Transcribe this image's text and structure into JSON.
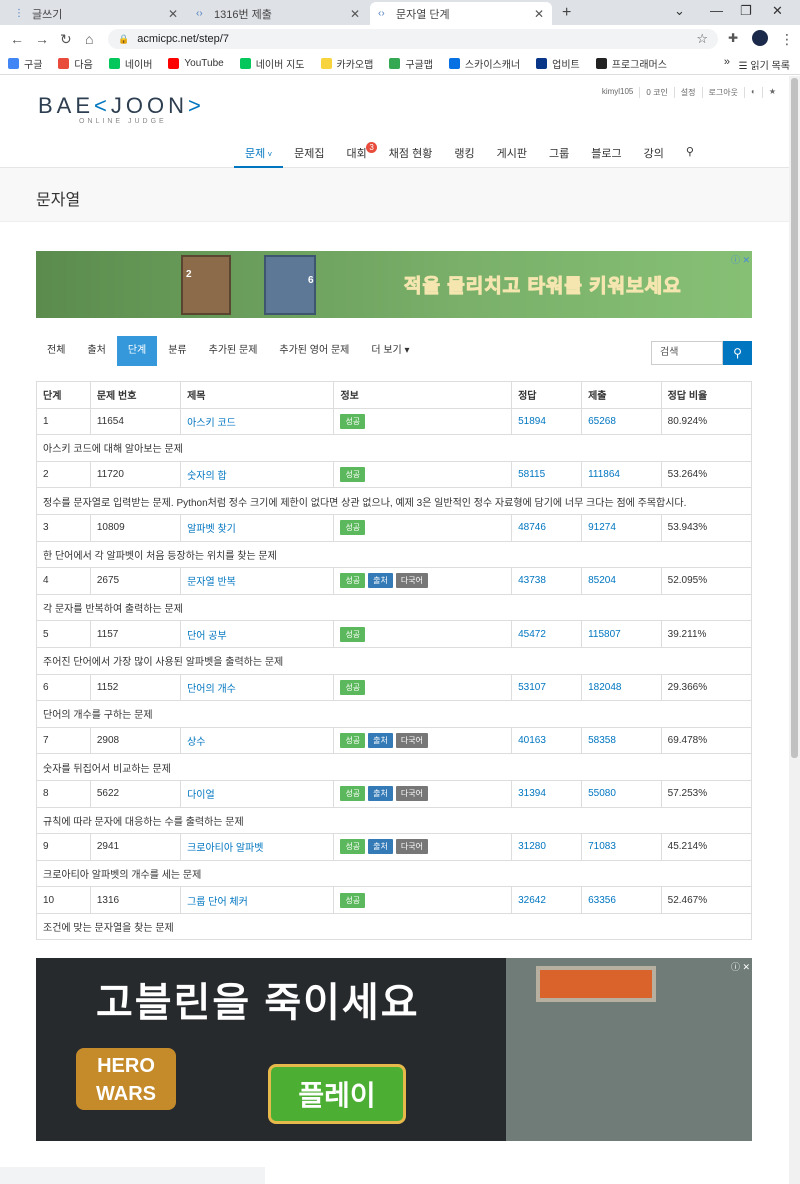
{
  "browser": {
    "tabs": [
      {
        "label": "글쓰기",
        "active": false
      },
      {
        "label": "1316번 제출",
        "active": false
      },
      {
        "label": "문자열 단계",
        "active": true
      }
    ],
    "url": "acmicpc.net/step/7",
    "bookmarks": [
      {
        "label": "구글",
        "color": "#4285f4"
      },
      {
        "label": "다음",
        "color": "#e84a3b"
      },
      {
        "label": "네이버",
        "color": "#03c75a"
      },
      {
        "label": "YouTube",
        "color": "#ff0000"
      },
      {
        "label": "네이버 지도",
        "color": "#03c75a"
      },
      {
        "label": "카카오맵",
        "color": "#f7d33d"
      },
      {
        "label": "구글맵",
        "color": "#34a853"
      },
      {
        "label": "스카이스캐너",
        "color": "#0770e3"
      },
      {
        "label": "업비트",
        "color": "#093687"
      },
      {
        "label": "프로그래머스",
        "color": "#222"
      }
    ],
    "more": "»",
    "reading_list": "읽기 목록"
  },
  "site": {
    "logo_main": "BAEKJOON",
    "logo_sub": "ONLINE JUDGE",
    "topbar": [
      "kimyl105",
      "0 코인",
      "설정",
      "로그아웃"
    ],
    "nav": [
      {
        "label": "문제",
        "active": true
      },
      {
        "label": "문제집"
      },
      {
        "label": "대회",
        "badge": "3"
      },
      {
        "label": "채점 현황"
      },
      {
        "label": "랭킹"
      },
      {
        "label": "게시판"
      },
      {
        "label": "그룹"
      },
      {
        "label": "블로그"
      },
      {
        "label": "강의"
      }
    ]
  },
  "page_title": "문자열",
  "ad1_text": "적을 물리치고 타워를 키워보세요",
  "ad1_nums": [
    "2",
    "6"
  ],
  "subnav": [
    "전체",
    "출처",
    "단계",
    "분류",
    "추가된 문제",
    "추가된 영어 문제",
    "더 보기"
  ],
  "search_placeholder": "검색",
  "table": {
    "headers": [
      "단계",
      "문제 번호",
      "제목",
      "정보",
      "정답",
      "제출",
      "정답 비율"
    ],
    "rows": [
      {
        "step": "1",
        "id": "11654",
        "title": "아스키 코드",
        "labels": [
          "성공"
        ],
        "ac": "51894",
        "sub": "65268",
        "ratio": "80.924%",
        "desc": "아스키 코드에 대해 알아보는 문제"
      },
      {
        "step": "2",
        "id": "11720",
        "title": "숫자의 합",
        "labels": [
          "성공"
        ],
        "ac": "58115",
        "sub": "111864",
        "ratio": "53.264%",
        "desc": "정수를 문자열로 입력받는 문제. Python처럼 정수 크기에 제한이 없다면 상관 없으나, 예제 3은 일반적인 정수 자료형에 담기에 너무 크다는 점에 주목합시다."
      },
      {
        "step": "3",
        "id": "10809",
        "title": "알파벳 찾기",
        "labels": [
          "성공"
        ],
        "ac": "48746",
        "sub": "91274",
        "ratio": "53.943%",
        "desc": "한 단어에서 각 알파벳이 처음 등장하는 위치를 찾는 문제"
      },
      {
        "step": "4",
        "id": "2675",
        "title": "문자열 반복",
        "labels": [
          "성공",
          "출처",
          "다국어"
        ],
        "ac": "43738",
        "sub": "85204",
        "ratio": "52.095%",
        "desc": "각 문자를 반복하여 출력하는 문제"
      },
      {
        "step": "5",
        "id": "1157",
        "title": "단어 공부",
        "labels": [
          "성공"
        ],
        "ac": "45472",
        "sub": "115807",
        "ratio": "39.211%",
        "desc": "주어진 단어에서 가장 많이 사용된 알파벳을 출력하는 문제"
      },
      {
        "step": "6",
        "id": "1152",
        "title": "단어의 개수",
        "labels": [
          "성공"
        ],
        "ac": "53107",
        "sub": "182048",
        "ratio": "29.366%",
        "desc": "단어의 개수를 구하는 문제"
      },
      {
        "step": "7",
        "id": "2908",
        "title": "상수",
        "labels": [
          "성공",
          "출처",
          "다국어"
        ],
        "ac": "40163",
        "sub": "58358",
        "ratio": "69.478%",
        "desc": "숫자를 뒤집어서 비교하는 문제"
      },
      {
        "step": "8",
        "id": "5622",
        "title": "다이얼",
        "labels": [
          "성공",
          "출처",
          "다국어"
        ],
        "ac": "31394",
        "sub": "55080",
        "ratio": "57.253%",
        "desc": "규칙에 따라 문자에 대응하는 수를 출력하는 문제"
      },
      {
        "step": "9",
        "id": "2941",
        "title": "크로아티아 알파벳",
        "labels": [
          "성공",
          "출처",
          "다국어"
        ],
        "ac": "31280",
        "sub": "71083",
        "ratio": "45.214%",
        "desc": "크로아티아 알파벳의 개수를 세는 문제"
      },
      {
        "step": "10",
        "id": "1316",
        "title": "그룹 단어 체커",
        "labels": [
          "성공"
        ],
        "ac": "32642",
        "sub": "63356",
        "ratio": "52.467%",
        "desc": "조건에 맞는 문자열을 찾는 문제"
      }
    ]
  },
  "ad2": {
    "title": "고블린을 죽이세요",
    "logo": "HERO WARS",
    "play": "플레이"
  }
}
